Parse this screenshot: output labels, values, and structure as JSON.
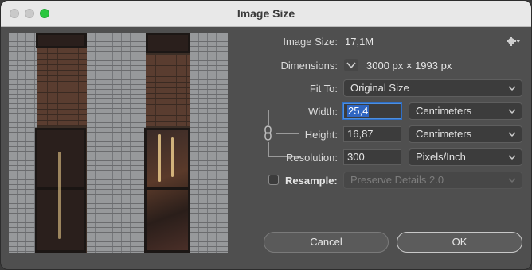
{
  "window": {
    "title": "Image Size"
  },
  "info": {
    "image_size_label": "Image Size:",
    "image_size_value": "17,1M",
    "dimensions_label": "Dimensions:",
    "dimensions_value": "3000 px  ×  1993 px"
  },
  "fit_to": {
    "label": "Fit To:",
    "value": "Original Size"
  },
  "width": {
    "label": "Width:",
    "value": "25,4",
    "unit": "Centimeters"
  },
  "height": {
    "label": "Height:",
    "value": "16,87",
    "unit": "Centimeters"
  },
  "resolution": {
    "label": "Resolution:",
    "value": "300",
    "unit": "Pixels/Inch"
  },
  "resample": {
    "label": "Resample:",
    "checked": false,
    "method": "Preserve Details 2.0"
  },
  "buttons": {
    "cancel": "Cancel",
    "ok": "OK"
  },
  "icons": {
    "settings": "gear-icon",
    "link": "chain-link-icon",
    "dropdown": "chevron-down-icon"
  },
  "colors": {
    "accent": "#2f66c2",
    "maximize": "#2ac73f"
  }
}
